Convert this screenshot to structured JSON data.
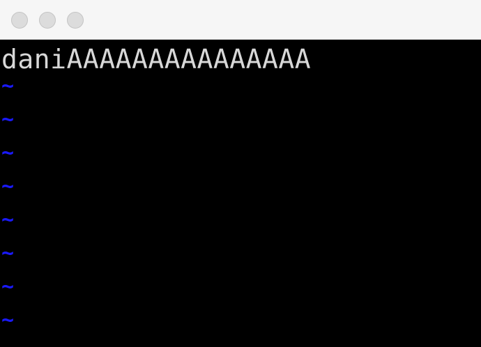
{
  "editor": {
    "buffer_text": "daniAAAAAAAAAAAAAAA",
    "empty_line_marker": "~",
    "empty_line_count": 8
  },
  "colors": {
    "background": "#000000",
    "text": "#d8d8d8",
    "tilde": "#1a1aff",
    "titlebar": "#f6f6f6"
  }
}
